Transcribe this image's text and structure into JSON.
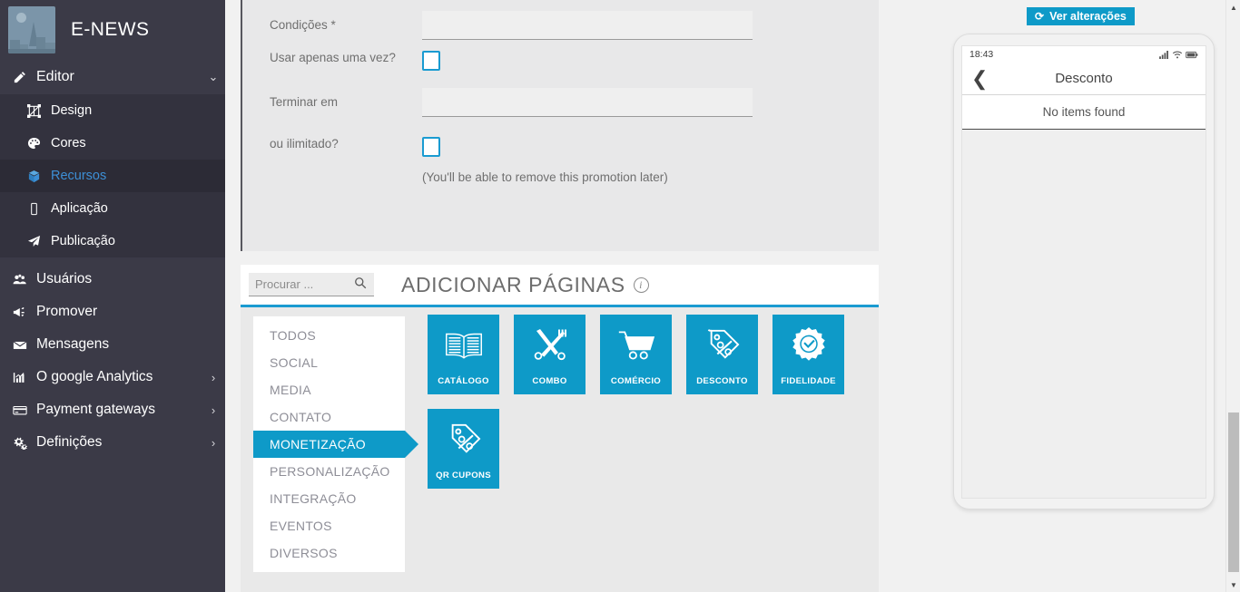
{
  "app": {
    "brand_title": "E-NEWS",
    "accent_blue": "#0e9ac8",
    "sidebar_bg": "#3b3a47",
    "sidebar_active_text": "#3d8fd6"
  },
  "sidebar": {
    "group": {
      "label": "Editor",
      "icon": "pencil-icon",
      "caret": "⌄"
    },
    "sub_items": [
      {
        "label": "Design",
        "icon": "design-icon",
        "active": false
      },
      {
        "label": "Cores",
        "icon": "palette-icon",
        "active": false
      },
      {
        "label": "Recursos",
        "icon": "box-icon",
        "active": true
      },
      {
        "label": "Aplicação",
        "icon": "mobile-icon",
        "active": false
      },
      {
        "label": "Publicação",
        "icon": "paper-plane-icon",
        "active": false
      }
    ],
    "main_items": [
      {
        "label": "Usuários",
        "icon": "users-icon",
        "caret": ""
      },
      {
        "label": "Promover",
        "icon": "megaphone-icon",
        "caret": ""
      },
      {
        "label": "Mensagens",
        "icon": "envelope-icon",
        "caret": ""
      },
      {
        "label": "O google Analytics",
        "icon": "bar-chart-icon",
        "caret": "›"
      },
      {
        "label": "Payment gateways",
        "icon": "credit-card-icon",
        "caret": "›"
      },
      {
        "label": "Definições",
        "icon": "gears-icon",
        "caret": "›"
      }
    ]
  },
  "form": {
    "rows": [
      {
        "label": "Condições *",
        "type": "text",
        "value": "",
        "placeholder": ""
      },
      {
        "label": "Usar apenas uma vez?",
        "type": "checkbox",
        "checked": false
      },
      {
        "label": "Terminar em",
        "type": "text",
        "value": "",
        "placeholder": ""
      },
      {
        "label": "ou ilimitado?",
        "type": "checkbox",
        "checked": false
      }
    ],
    "note": "(You'll be able to remove this promotion later)"
  },
  "pages": {
    "search_placeholder": "Procurar ...",
    "search_value": "",
    "title": "ADICIONAR PÁGINAS",
    "info_glyph": "i",
    "categories": [
      {
        "label": "TODOS",
        "active": false
      },
      {
        "label": "SOCIAL",
        "active": false
      },
      {
        "label": "MEDIA",
        "active": false
      },
      {
        "label": "CONTATO",
        "active": false
      },
      {
        "label": "MONETIZAÇÃO",
        "active": true
      },
      {
        "label": "PERSONALIZAÇÃO",
        "active": false
      },
      {
        "label": "INTEGRAÇÃO",
        "active": false
      },
      {
        "label": "EVENTOS",
        "active": false
      },
      {
        "label": "DIVERSOS",
        "active": false
      }
    ],
    "tiles": [
      {
        "label": "CATÁLOGO",
        "icon": "open-book-icon"
      },
      {
        "label": "COMBO",
        "icon": "fork-knife-icon"
      },
      {
        "label": "COMÉRCIO",
        "icon": "shopping-cart-icon"
      },
      {
        "label": "DESCONTO",
        "icon": "discount-tag-icon"
      },
      {
        "label": "FIDELIDADE",
        "icon": "loyalty-badge-icon"
      },
      {
        "label": "QR CUPONS",
        "icon": "coupon-tags-icon"
      }
    ]
  },
  "preview": {
    "changes_button": "Ver alterações",
    "changes_icon": "refresh-icon",
    "status_time": "18:43",
    "status_icons": [
      "signal-icon",
      "wifi-icon",
      "battery-icon"
    ],
    "back_icon": "chevron-left-icon",
    "app_title": "Desconto",
    "empty_message": "No items found"
  },
  "scrollbar": {
    "up_arrow": "▲",
    "down_arrow": "▼"
  }
}
